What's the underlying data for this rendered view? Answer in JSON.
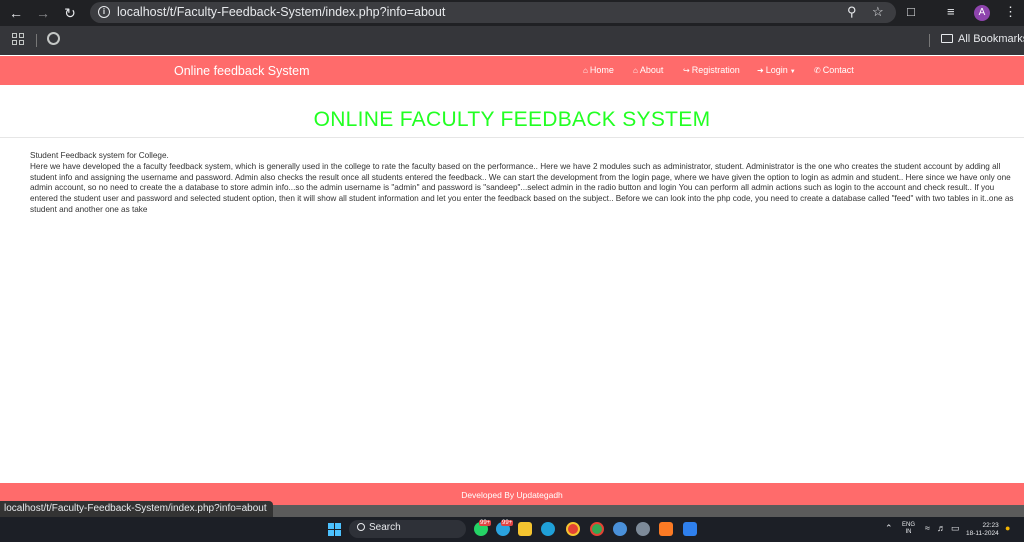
{
  "browser": {
    "url": "localhost/t/Faculty-Feedback-System/index.php?info=about",
    "status_url": "localhost/t/Faculty-Feedback-System/index.php?info=about",
    "bookmarks_label": "All Bookmarks",
    "avatar_letter": "A"
  },
  "navbar": {
    "brand": "Online feedback System",
    "color": "#ff6b6b",
    "links": [
      {
        "icon": "home-icon",
        "label": "Home"
      },
      {
        "icon": "home-icon",
        "label": "About"
      },
      {
        "icon": "sign-in-icon",
        "label": "Registration"
      },
      {
        "icon": "login-icon",
        "label": "Login"
      },
      {
        "icon": "phone-icon",
        "label": "Contact"
      }
    ]
  },
  "main": {
    "title": "ONLINE FACULTY FEEDBACK SYSTEM",
    "title_color": "#22ff22",
    "intro": "Student Feedback system for College.",
    "body": "Here we have developed the a faculty feedback system, which is generally used in the college to rate the faculty based on the performance.. Here we have 2 modules such as administrator, student. Administrator is the one who creates the student account by adding all student info and assigning the username and password. Admin also checks the result once all students entered the feedback.. We can start the development from the login page, where we have given the option to login as admin and student.. Here since we have only one admin account, so no need to create the a database to store admin info...so the admin username is \"admin\" and password is \"sandeep\"...select admin in the radio button and login You can perform all admin actions such as login to the account and check result.. If you entered the student user and password and selected student option, then it will show all student information and let you enter the feedback based on the subject.. Before we can look into the php code, you need to create a database called \"feed\" with two tables in it..one as student and another one as take"
  },
  "footer": {
    "text": "Developed By Updategadh"
  },
  "taskbar": {
    "search_label": "Search",
    "badge_1": "99+",
    "badge_2": "99+",
    "lang_line1": "ENG",
    "lang_line2": "IN",
    "time": "22:23",
    "date": "18-11-2024"
  }
}
